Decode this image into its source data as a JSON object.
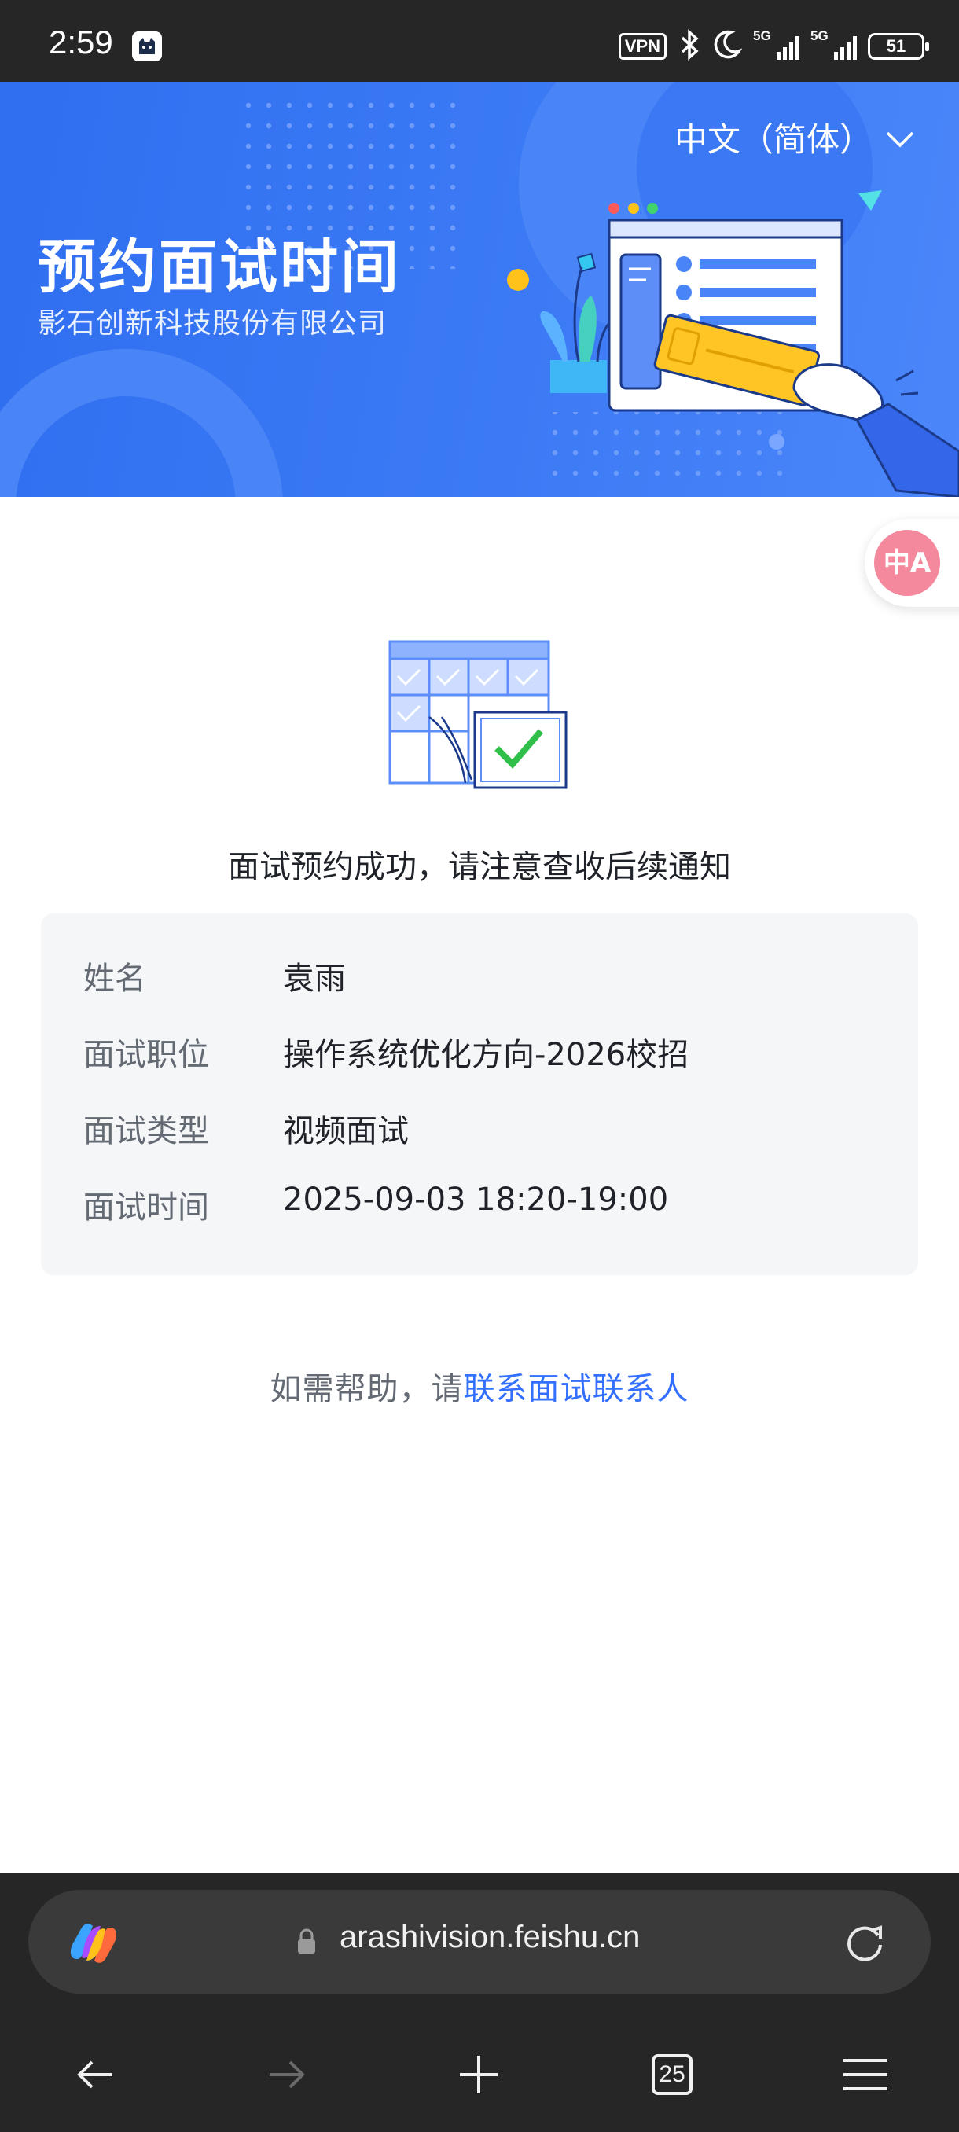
{
  "status_bar": {
    "time": "2:59",
    "vpn": "VPN",
    "signal1": "5G",
    "signal2": "5G",
    "battery": "51"
  },
  "header": {
    "language": "中文（简体）",
    "title": "预约面试时间",
    "company": "影石创新科技股份有限公司"
  },
  "translate_fab": "中A",
  "result": {
    "message": "面试预约成功，请注意查收后续通知"
  },
  "details": [
    {
      "label": "姓名",
      "value": "袁雨"
    },
    {
      "label": "面试职位",
      "value": "操作系统优化方向-2026校招"
    },
    {
      "label": "面试类型",
      "value": "视频面试"
    },
    {
      "label": "面试时间",
      "value": "2025-09-03 18:20-19:00"
    }
  ],
  "help": {
    "prefix": "如需帮助，请",
    "link": "联系面试联系人"
  },
  "browser": {
    "url": "arashivision.feishu.cn",
    "tab_count": "25"
  },
  "colors": {
    "banner": "#3476f3",
    "link": "#3370ff",
    "check": "#2fbf4a"
  }
}
